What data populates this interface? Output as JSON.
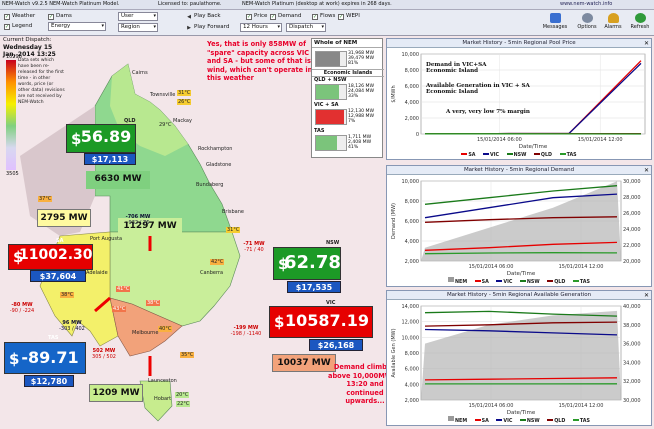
{
  "app": {
    "title_left": "NEM-Watch v9.2.5 NEM-Watch Platinum Model.",
    "license": "Licensed to: paulathome.",
    "expiry": "NEM-Watch Platinum (desktop at work) expires in 268 days.",
    "url": "www.nem-watch.info"
  },
  "toolbar": {
    "weather": "Weather",
    "dams": "Dams",
    "legend": "Legend",
    "energy": "Energy",
    "user": "User",
    "region": "Region",
    "play_back": "Play Back",
    "play_forward": "Play Forward",
    "hours": "12 Hours",
    "dispatch": "Dispatch",
    "price": "Price",
    "demand": "Demand",
    "flows": "Flows",
    "wepi": "WEPI",
    "messages": "Messages",
    "options": "Options",
    "alarms": "Alarms",
    "refresh": "Refresh"
  },
  "dispatch": {
    "label": "Current Dispatch:",
    "date": "Wednesday 15 Jan, 2014 13:25"
  },
  "scale": {
    "top": "10296",
    "bottom": "3505"
  },
  "info_note": "Data sets which have been re-released for the first time - in other words, price (or other data) revisions are not received by NEM-Watch",
  "annotations": {
    "spare": "Yes, that is only 858MW of \"spare\" capacity across VIC and SA - but some of that is wind, which can't operate in this weather",
    "demand": "Demand climbed above 10,000MW at 13:20 and continued upwards..."
  },
  "regions": {
    "qld": {
      "name": "QLD",
      "price": "56.89",
      "sub": "$17,113",
      "mw": "6630 MW"
    },
    "nsw": {
      "name": "NSW",
      "price": "62.78",
      "sub": "$17,535",
      "mw": "11297 MW"
    },
    "sa": {
      "name": "SA",
      "price": "11002.30",
      "sub": "$37,604",
      "mw": "2795 MW"
    },
    "vic": {
      "name": "VIC",
      "price": "10587.19",
      "sub": "$26,168",
      "mw": "10037 MW"
    },
    "tas": {
      "name": "TAS",
      "price": "-89.71",
      "sub": "$12,780",
      "mw": "1209 MW"
    }
  },
  "flows": {
    "qld_nsw": "-706 MW",
    "qld_nsw_lim": "-932 / 76",
    "nsw_vic": "-71 MW",
    "nsw_vic_lim": "-71 / 40",
    "vic_sa": "96 MW",
    "vic_sa_lim": "-303 / 402",
    "sa_vic_murray": "-80 MW",
    "sa_vic_murray_lim": "-90 / -224",
    "basslink": "502 MW",
    "basslink_lim": "305 / 502",
    "vic_nsw": "-199 MW",
    "vic_nsw_lim": "-198 / -1140"
  },
  "temps": [
    "31°C",
    "26°C",
    "29°C",
    "37°C",
    "38°C",
    "32°C",
    "36°C",
    "41°C",
    "38°C",
    "43°C",
    "40°C",
    "42°C",
    "35°C",
    "36°C",
    "42°C",
    "31°C",
    "21°C",
    "20°C",
    "22°C",
    "26°C",
    "24°C"
  ],
  "places": [
    "Cairns",
    "Townsville",
    "Mackay",
    "Rockhampton",
    "Gladstone",
    "Bundaberg",
    "Brisbane",
    "Gold Coast",
    "Port Augusta",
    "Adelaide",
    "Canberra",
    "Melbourne",
    "Hobart",
    "Launceston",
    "Mildura",
    "Wagga"
  ],
  "nem_panel": {
    "title": "Whole of NEM",
    "whole": [
      "31,968 MW",
      "39,479 MW",
      "81%"
    ],
    "islands": "Economic Islands",
    "qld_nsw_title": "QLD + NSW",
    "qld_nsw": [
      "18,126 MW",
      "24,084 MW",
      "33%"
    ],
    "vic_sa_title": "VIC + SA",
    "vic_sa": [
      "12,130 MW",
      "12,988 MW",
      "7%"
    ],
    "tas_title": "TAS",
    "tas": [
      "1,711 MW",
      "2,408 MW",
      "41%"
    ]
  },
  "colors": {
    "nsw": "#1a7a1a",
    "qld": "#800000",
    "sa": "#e60000",
    "vic": "#0a0a8a",
    "tas": "#2a9a2a",
    "nem": "#7a7a7a",
    "price_green": "#1c9a26",
    "price_red": "#e00000",
    "price_blue": "#1565c8"
  },
  "charts": {
    "price": {
      "title": "Market History - 5min Regional Pool Price",
      "ylabel": "$/MWh",
      "xlabel": "Date/Time",
      "xticks": [
        "15/01/2014 06:00",
        "15/01/2014 12:00"
      ],
      "yticks": [
        "10,000",
        "8,000",
        "6,000",
        "4,000",
        "2,000",
        "0"
      ],
      "legend": [
        "SA",
        "VIC",
        "NSW",
        "QLD",
        "TAS"
      ],
      "callouts": [
        "Demand in VIC+SA Economic Island",
        "Available Generation in VIC + SA Economic Island",
        "A very, very low 7% margin"
      ]
    },
    "demand": {
      "title": "Market History - 5min Regional Demand",
      "ylabel": "Demand (MW)",
      "xlabel": "Date/Time",
      "xticks": [
        "15/01/2014 06:00",
        "15/01/2014 12:00"
      ],
      "yticks": [
        "10,000",
        "8,000",
        "6,000",
        "4,000",
        "2,000"
      ],
      "yticks_right": [
        "30,000",
        "28,000",
        "26,000",
        "24,000",
        "22,000",
        "20,000"
      ],
      "legend": [
        "NEM",
        "SA",
        "VIC",
        "NSW",
        "QLD",
        "TAS"
      ]
    },
    "avail": {
      "title": "Market History - 5min Regional Available Generation",
      "ylabel": "Available Gen (MW)",
      "xlabel": "Date/Time",
      "xticks": [
        "15/01/2014 06:00",
        "15/01/2014 12:00"
      ],
      "yticks": [
        "14,000",
        "12,000",
        "10,000",
        "8,000",
        "6,000",
        "4,000",
        "2,000"
      ],
      "yticks_right": [
        "40,000",
        "38,000",
        "36,000",
        "34,000",
        "32,000",
        "30,000"
      ],
      "legend": [
        "NEM",
        "SA",
        "VIC",
        "NSW",
        "QLD",
        "TAS"
      ]
    }
  },
  "chart_data": [
    {
      "type": "line",
      "title": "Market History - 5min Regional Pool Price",
      "xlabel": "Date/Time",
      "ylabel": "$/MWh",
      "x": [
        "15/01/2014 06:00",
        "15/01/2014 12:00"
      ],
      "ylim": [
        0,
        12000
      ],
      "series": [
        {
          "name": "SA",
          "values": [
            50,
            60,
            80,
            11002
          ]
        },
        {
          "name": "VIC",
          "values": [
            45,
            55,
            70,
            10587
          ]
        },
        {
          "name": "NSW",
          "values": [
            40,
            45,
            55,
            63
          ]
        },
        {
          "name": "QLD",
          "values": [
            40,
            45,
            50,
            57
          ]
        },
        {
          "name": "TAS",
          "values": [
            30,
            35,
            20,
            -90
          ]
        }
      ]
    },
    {
      "type": "line",
      "title": "Market History - 5min Regional Demand",
      "xlabel": "Date/Time",
      "ylabel": "Demand (MW)",
      "x": [
        "15/01/2014 06:00",
        "15/01/2014 12:00"
      ],
      "ylim": [
        0,
        12000
      ],
      "series": [
        {
          "name": "NEM",
          "values": [
            22000,
            25000,
            28000,
            31968
          ]
        },
        {
          "name": "SA",
          "values": [
            1600,
            2000,
            2500,
            2795
          ]
        },
        {
          "name": "VIC",
          "values": [
            6500,
            8000,
            9500,
            10037
          ]
        },
        {
          "name": "NSW",
          "values": [
            8500,
            9500,
            10500,
            11297
          ]
        },
        {
          "name": "QLD",
          "values": [
            5800,
            6200,
            6500,
            6630
          ]
        },
        {
          "name": "TAS",
          "values": [
            1100,
            1200,
            1250,
            1209
          ]
        }
      ]
    },
    {
      "type": "line",
      "title": "Market History - 5min Regional Available Generation",
      "xlabel": "Date/Time",
      "ylabel": "Available Gen (MW)",
      "x": [
        "15/01/2014 06:00",
        "15/01/2014 12:00"
      ],
      "ylim": [
        0,
        14000
      ],
      "series": [
        {
          "name": "NEM",
          "values": [
            36000,
            38000,
            39000,
            39479
          ]
        },
        {
          "name": "SA",
          "values": [
            3000,
            3100,
            3200,
            3300
          ]
        },
        {
          "name": "VIC",
          "values": [
            10500,
            10300,
            10000,
            9700
          ]
        },
        {
          "name": "NSW",
          "values": [
            13000,
            13200,
            12800,
            12500
          ]
        },
        {
          "name": "QLD",
          "values": [
            11000,
            11200,
            11500,
            11600
          ]
        },
        {
          "name": "TAS",
          "values": [
            2400,
            2400,
            2400,
            2408
          ]
        }
      ]
    }
  ]
}
